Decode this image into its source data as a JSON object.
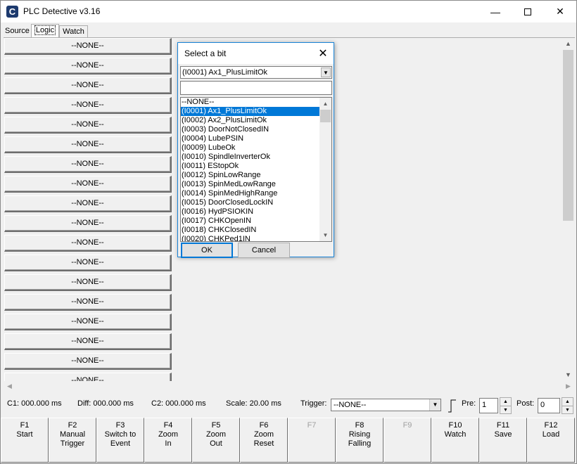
{
  "window": {
    "title": "PLC Detective v3.16",
    "app_icon_letter": "C",
    "minimize_glyph": "—",
    "close_glyph": "✕"
  },
  "tabs": [
    {
      "label": "Source",
      "active": false
    },
    {
      "label": "Logic",
      "active": true
    },
    {
      "label": "Watch",
      "active": false
    }
  ],
  "bit_buttons": [
    "--NONE--",
    "--NONE--",
    "--NONE--",
    "--NONE--",
    "--NONE--",
    "--NONE--",
    "--NONE--",
    "--NONE--",
    "--NONE--",
    "--NONE--",
    "--NONE--",
    "--NONE--",
    "--NONE--",
    "--NONE--",
    "--NONE--",
    "--NONE--",
    "--NONE--",
    "--NONE--"
  ],
  "status": {
    "c1": "C1: 000.000 ms",
    "diff": "Diff: 000.000 ms",
    "c2": "C2: 000.000 ms",
    "scale": "Scale: 20.00 ms",
    "trigger_label": "Trigger:",
    "trigger_value": "--NONE--",
    "pre_label": "Pre:",
    "pre_value": "1",
    "post_label": "Post:",
    "post_value": "0"
  },
  "fkeys": [
    {
      "label": "F1\nStart",
      "enabled": true
    },
    {
      "label": "F2\nManual\nTrigger",
      "enabled": true
    },
    {
      "label": "F3\nSwitch to\nEvent",
      "enabled": true
    },
    {
      "label": "F4\nZoom\nIn",
      "enabled": true
    },
    {
      "label": "F5\nZoom\nOut",
      "enabled": true
    },
    {
      "label": "F6\nZoom\nReset",
      "enabled": true
    },
    {
      "label": "F7",
      "enabled": false
    },
    {
      "label": "F8\nRising\nFalling",
      "enabled": true
    },
    {
      "label": "F9",
      "enabled": false
    },
    {
      "label": "F10\nWatch",
      "enabled": true
    },
    {
      "label": "F11\nSave",
      "enabled": true
    },
    {
      "label": "F12\nLoad",
      "enabled": true
    }
  ],
  "dialog": {
    "title": "Select a bit",
    "selected_bit": "(I0001) Ax1_PlusLimitOk",
    "filter_value": "",
    "items": [
      "--NONE--",
      "(I0001) Ax1_PlusLimitOk",
      "(I0002) Ax2_PlusLimitOk",
      "(I0003) DoorNotClosedIN",
      "(I0004) LubePSIN",
      "(I0009) LubeOk",
      "(I0010) SpindleInverterOk",
      "(I0011) EStopOk",
      "(I0012) SpinLowRange",
      "(I0013) SpinMedLowRange",
      "(I0014) SpinMedHighRange",
      "(I0015) DoorClosedLockIN",
      "(I0016) HydPSIOKIN",
      "(I0017) CHKOpenIN",
      "(I0018) CHKClosedIN",
      "(I0020) CHKPed1IN"
    ],
    "selected_index": 1,
    "ok_label": "OK",
    "cancel_label": "Cancel"
  }
}
